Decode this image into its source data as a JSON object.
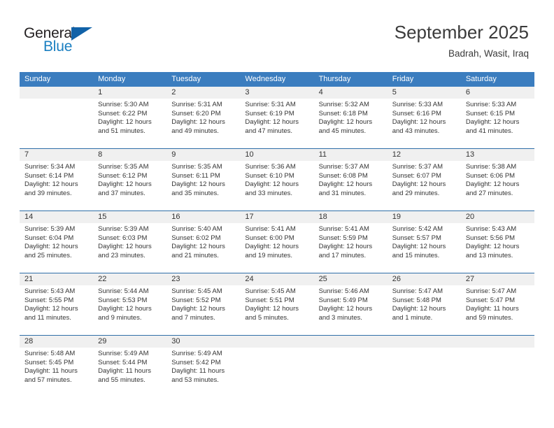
{
  "brand": {
    "word_general": "General",
    "word_blue": "Blue",
    "accent_color": "#1162a8",
    "blue_text_color": "#1a7fc1"
  },
  "header": {
    "title": "September 2025",
    "location": "Badrah, Wasit, Iraq"
  },
  "calendar": {
    "header_bg": "#3b7dbf",
    "number_row_bg": "#f0f0f0",
    "weekdays": [
      "Sunday",
      "Monday",
      "Tuesday",
      "Wednesday",
      "Thursday",
      "Friday",
      "Saturday"
    ],
    "weeks": [
      [
        {
          "day": "",
          "sunrise": "",
          "sunset": "",
          "daylight_1": "",
          "daylight_2": ""
        },
        {
          "day": "1",
          "sunrise": "Sunrise: 5:30 AM",
          "sunset": "Sunset: 6:22 PM",
          "daylight_1": "Daylight: 12 hours",
          "daylight_2": "and 51 minutes."
        },
        {
          "day": "2",
          "sunrise": "Sunrise: 5:31 AM",
          "sunset": "Sunset: 6:20 PM",
          "daylight_1": "Daylight: 12 hours",
          "daylight_2": "and 49 minutes."
        },
        {
          "day": "3",
          "sunrise": "Sunrise: 5:31 AM",
          "sunset": "Sunset: 6:19 PM",
          "daylight_1": "Daylight: 12 hours",
          "daylight_2": "and 47 minutes."
        },
        {
          "day": "4",
          "sunrise": "Sunrise: 5:32 AM",
          "sunset": "Sunset: 6:18 PM",
          "daylight_1": "Daylight: 12 hours",
          "daylight_2": "and 45 minutes."
        },
        {
          "day": "5",
          "sunrise": "Sunrise: 5:33 AM",
          "sunset": "Sunset: 6:16 PM",
          "daylight_1": "Daylight: 12 hours",
          "daylight_2": "and 43 minutes."
        },
        {
          "day": "6",
          "sunrise": "Sunrise: 5:33 AM",
          "sunset": "Sunset: 6:15 PM",
          "daylight_1": "Daylight: 12 hours",
          "daylight_2": "and 41 minutes."
        }
      ],
      [
        {
          "day": "7",
          "sunrise": "Sunrise: 5:34 AM",
          "sunset": "Sunset: 6:14 PM",
          "daylight_1": "Daylight: 12 hours",
          "daylight_2": "and 39 minutes."
        },
        {
          "day": "8",
          "sunrise": "Sunrise: 5:35 AM",
          "sunset": "Sunset: 6:12 PM",
          "daylight_1": "Daylight: 12 hours",
          "daylight_2": "and 37 minutes."
        },
        {
          "day": "9",
          "sunrise": "Sunrise: 5:35 AM",
          "sunset": "Sunset: 6:11 PM",
          "daylight_1": "Daylight: 12 hours",
          "daylight_2": "and 35 minutes."
        },
        {
          "day": "10",
          "sunrise": "Sunrise: 5:36 AM",
          "sunset": "Sunset: 6:10 PM",
          "daylight_1": "Daylight: 12 hours",
          "daylight_2": "and 33 minutes."
        },
        {
          "day": "11",
          "sunrise": "Sunrise: 5:37 AM",
          "sunset": "Sunset: 6:08 PM",
          "daylight_1": "Daylight: 12 hours",
          "daylight_2": "and 31 minutes."
        },
        {
          "day": "12",
          "sunrise": "Sunrise: 5:37 AM",
          "sunset": "Sunset: 6:07 PM",
          "daylight_1": "Daylight: 12 hours",
          "daylight_2": "and 29 minutes."
        },
        {
          "day": "13",
          "sunrise": "Sunrise: 5:38 AM",
          "sunset": "Sunset: 6:06 PM",
          "daylight_1": "Daylight: 12 hours",
          "daylight_2": "and 27 minutes."
        }
      ],
      [
        {
          "day": "14",
          "sunrise": "Sunrise: 5:39 AM",
          "sunset": "Sunset: 6:04 PM",
          "daylight_1": "Daylight: 12 hours",
          "daylight_2": "and 25 minutes."
        },
        {
          "day": "15",
          "sunrise": "Sunrise: 5:39 AM",
          "sunset": "Sunset: 6:03 PM",
          "daylight_1": "Daylight: 12 hours",
          "daylight_2": "and 23 minutes."
        },
        {
          "day": "16",
          "sunrise": "Sunrise: 5:40 AM",
          "sunset": "Sunset: 6:02 PM",
          "daylight_1": "Daylight: 12 hours",
          "daylight_2": "and 21 minutes."
        },
        {
          "day": "17",
          "sunrise": "Sunrise: 5:41 AM",
          "sunset": "Sunset: 6:00 PM",
          "daylight_1": "Daylight: 12 hours",
          "daylight_2": "and 19 minutes."
        },
        {
          "day": "18",
          "sunrise": "Sunrise: 5:41 AM",
          "sunset": "Sunset: 5:59 PM",
          "daylight_1": "Daylight: 12 hours",
          "daylight_2": "and 17 minutes."
        },
        {
          "day": "19",
          "sunrise": "Sunrise: 5:42 AM",
          "sunset": "Sunset: 5:57 PM",
          "daylight_1": "Daylight: 12 hours",
          "daylight_2": "and 15 minutes."
        },
        {
          "day": "20",
          "sunrise": "Sunrise: 5:43 AM",
          "sunset": "Sunset: 5:56 PM",
          "daylight_1": "Daylight: 12 hours",
          "daylight_2": "and 13 minutes."
        }
      ],
      [
        {
          "day": "21",
          "sunrise": "Sunrise: 5:43 AM",
          "sunset": "Sunset: 5:55 PM",
          "daylight_1": "Daylight: 12 hours",
          "daylight_2": "and 11 minutes."
        },
        {
          "day": "22",
          "sunrise": "Sunrise: 5:44 AM",
          "sunset": "Sunset: 5:53 PM",
          "daylight_1": "Daylight: 12 hours",
          "daylight_2": "and 9 minutes."
        },
        {
          "day": "23",
          "sunrise": "Sunrise: 5:45 AM",
          "sunset": "Sunset: 5:52 PM",
          "daylight_1": "Daylight: 12 hours",
          "daylight_2": "and 7 minutes."
        },
        {
          "day": "24",
          "sunrise": "Sunrise: 5:45 AM",
          "sunset": "Sunset: 5:51 PM",
          "daylight_1": "Daylight: 12 hours",
          "daylight_2": "and 5 minutes."
        },
        {
          "day": "25",
          "sunrise": "Sunrise: 5:46 AM",
          "sunset": "Sunset: 5:49 PM",
          "daylight_1": "Daylight: 12 hours",
          "daylight_2": "and 3 minutes."
        },
        {
          "day": "26",
          "sunrise": "Sunrise: 5:47 AM",
          "sunset": "Sunset: 5:48 PM",
          "daylight_1": "Daylight: 12 hours",
          "daylight_2": "and 1 minute."
        },
        {
          "day": "27",
          "sunrise": "Sunrise: 5:47 AM",
          "sunset": "Sunset: 5:47 PM",
          "daylight_1": "Daylight: 11 hours",
          "daylight_2": "and 59 minutes."
        }
      ],
      [
        {
          "day": "28",
          "sunrise": "Sunrise: 5:48 AM",
          "sunset": "Sunset: 5:45 PM",
          "daylight_1": "Daylight: 11 hours",
          "daylight_2": "and 57 minutes."
        },
        {
          "day": "29",
          "sunrise": "Sunrise: 5:49 AM",
          "sunset": "Sunset: 5:44 PM",
          "daylight_1": "Daylight: 11 hours",
          "daylight_2": "and 55 minutes."
        },
        {
          "day": "30",
          "sunrise": "Sunrise: 5:49 AM",
          "sunset": "Sunset: 5:42 PM",
          "daylight_1": "Daylight: 11 hours",
          "daylight_2": "and 53 minutes."
        },
        {
          "day": "",
          "sunrise": "",
          "sunset": "",
          "daylight_1": "",
          "daylight_2": ""
        },
        {
          "day": "",
          "sunrise": "",
          "sunset": "",
          "daylight_1": "",
          "daylight_2": ""
        },
        {
          "day": "",
          "sunrise": "",
          "sunset": "",
          "daylight_1": "",
          "daylight_2": ""
        },
        {
          "day": "",
          "sunrise": "",
          "sunset": "",
          "daylight_1": "",
          "daylight_2": ""
        }
      ]
    ]
  }
}
